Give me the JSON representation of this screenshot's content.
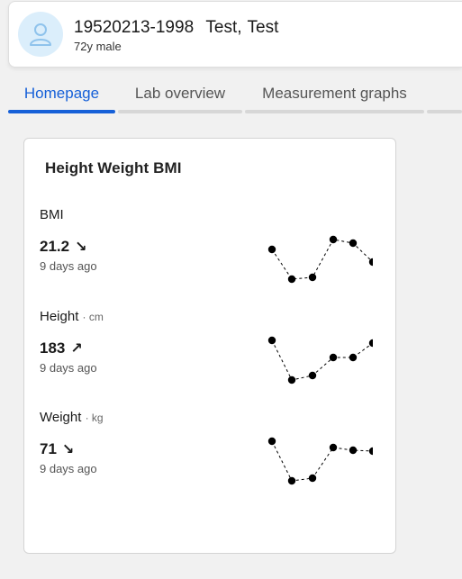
{
  "patient": {
    "id": "19520213-1998",
    "surname": "Test,",
    "given": "Test",
    "meta": "72y male"
  },
  "tabs": [
    {
      "label": "Homepage",
      "active": true
    },
    {
      "label": "Lab overview",
      "active": false
    },
    {
      "label": "Measurement graphs",
      "active": false
    }
  ],
  "card": {
    "title": "Height Weight BMI",
    "metrics": [
      {
        "label": "BMI",
        "unit": "",
        "value": "21.2",
        "trend": "down",
        "time": "9 days ago",
        "trend_icon": "arrow-down-right-icon"
      },
      {
        "label": "Height",
        "unit": "· cm",
        "value": "183",
        "trend": "up",
        "time": "9 days ago",
        "trend_icon": "arrow-up-right-icon"
      },
      {
        "label": "Weight",
        "unit": "· kg",
        "value": "71",
        "trend": "down",
        "time": "9 days ago",
        "trend_icon": "arrow-down-right-icon"
      }
    ]
  },
  "colors": {
    "accent": "#1660d8",
    "avatar_bg": "#dbeefb",
    "avatar_icon": "#8fc3ec"
  }
}
